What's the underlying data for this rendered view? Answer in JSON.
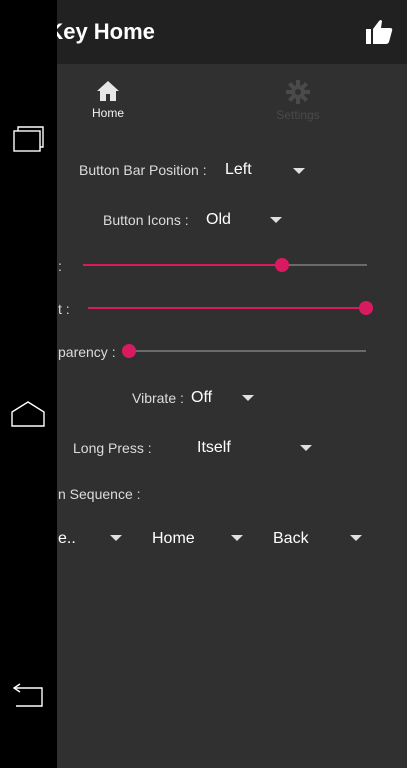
{
  "app": {
    "title": "tKey Home"
  },
  "tabs": [
    {
      "label": "Home",
      "icon": "home-icon",
      "active": true
    },
    {
      "label": "Settings",
      "icon": "gear-icon",
      "active": false
    }
  ],
  "settings": {
    "button_bar_position": {
      "label": "Button Bar Position :",
      "value": "Left"
    },
    "button_icons": {
      "label": "Button Icons :",
      "value": "Old"
    },
    "slider1": {
      "label": ":",
      "level": 0.7
    },
    "slider2": {
      "label": "t :",
      "level": 1.0
    },
    "transparency": {
      "label": "parency :",
      "level": 0.0
    },
    "vibrate": {
      "label": "Vibrate :",
      "value": "Off"
    },
    "long_press": {
      "label": "Long Press :",
      "value": "Itself"
    },
    "sequence": {
      "label": "n Sequence :",
      "values": [
        "e..",
        "Home",
        "Back"
      ]
    }
  },
  "colors": {
    "accent": "#d81b60",
    "appbar": "#212121",
    "background": "#303030",
    "navbar": "#000000"
  },
  "navbar": {
    "icons": [
      "recents-icon",
      "home-icon",
      "back-icon"
    ]
  }
}
